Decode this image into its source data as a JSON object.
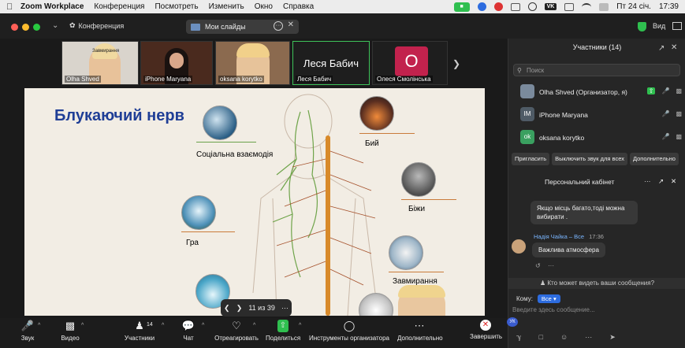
{
  "menubar": {
    "app": "Zoom Workplace",
    "items": [
      "Конференция",
      "Посмотреть",
      "Изменить",
      "Окно",
      "Справка"
    ],
    "vk": "VK",
    "datetime": "Пт 24 січ.",
    "time": "17:39"
  },
  "titlebar": {
    "conference": "Конференция",
    "slides_tab": "Мои слайды",
    "view": "Вид"
  },
  "thumbnails": [
    {
      "name": "Olha Shved",
      "overlay": "Завмирання"
    },
    {
      "name": "iPhone Maryana"
    },
    {
      "name": "oksana korytko"
    },
    {
      "name": "Леся Бабич",
      "big": "Леся Бабич"
    },
    {
      "name": "Олеся Смолінська",
      "letter": "О"
    }
  ],
  "slide": {
    "title": "Блукаючий нерв",
    "labels": {
      "social": "Соціальна взаємодія",
      "fight": "Бий",
      "run": "Біжи",
      "play": "Гра",
      "freeze": "Завмирання"
    },
    "page": "11 из 39"
  },
  "toolbar": {
    "audio": "Звук",
    "video": "Видео",
    "participants": "Участники",
    "participants_count": "14",
    "chat": "Чат",
    "react": "Отреагировать",
    "share": "Поделиться",
    "host_tools": "Инструменты организатора",
    "more": "Дополнительно",
    "end": "Завершить"
  },
  "sidebar": {
    "title": "Участники (14)",
    "search_placeholder": "Поиск",
    "participants": [
      {
        "name": "Olha Shved (Организатор, я)",
        "initials": "",
        "color": "#7a8a9c"
      },
      {
        "name": "iPhone Maryana",
        "initials": "IM",
        "color": "#4f5b66"
      },
      {
        "name": "oksana korytko",
        "initials": "ok",
        "color": "#3aa060"
      }
    ],
    "buttons": [
      "Пригласить",
      "Выключить звук для всех",
      "Дополнительно"
    ],
    "chat_title": "Персональний кабінет",
    "messages": [
      {
        "text1": "Якщо місць багато,тоді можна",
        "text2": "вибирати ."
      },
      {
        "author": "Надія Чайка",
        "to": "– Все",
        "time": "17:36",
        "text": "Важлива атмосфера"
      }
    ],
    "notice": "Кто может видеть ваши сообщения?",
    "to_label": "Кому:",
    "to_value": "Все",
    "input_placeholder": "Введите здесь сообщение...",
    "user_initials": "УК"
  }
}
